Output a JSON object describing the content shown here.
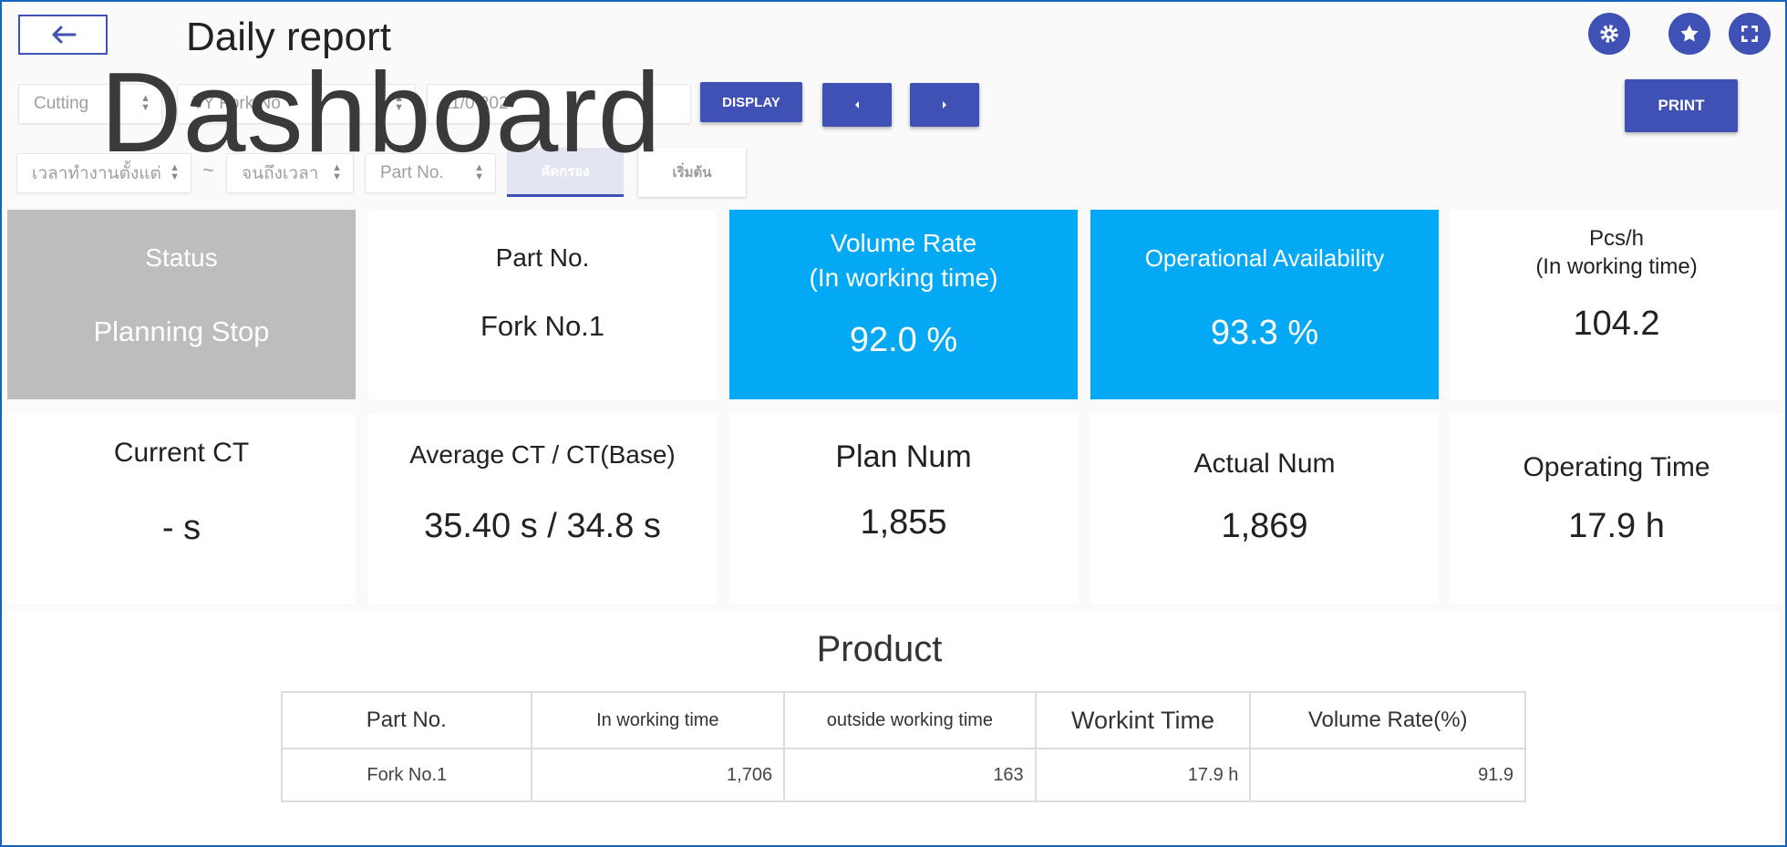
{
  "header": {
    "title": "Daily report",
    "watermark": "Dashboard",
    "back_icon": "arrow-left-icon",
    "settings_icon": "gear-icon",
    "favorite_icon": "star-icon",
    "fullscreen_icon": "fullscreen-icon"
  },
  "filters": {
    "process": "Cutting",
    "machine": "TY Fork No",
    "date": "11/0 202",
    "work_time_from": "เวลาทำงานตั้งแต่",
    "tilde": "~",
    "work_time_to": "จนถึงเวลา",
    "part_no": "Part No.",
    "filter_label": "คัดกรอง",
    "reset_label": "เริ่มต้น"
  },
  "toolbar": {
    "display_label": "DISPLAY",
    "prev_icon": "caret-left-icon",
    "next_icon": "caret-right-icon",
    "print_label": "PRINT"
  },
  "cards": {
    "status": {
      "label": "Status",
      "value": "Planning Stop"
    },
    "part_no": {
      "label": "Part No.",
      "value": "Fork No.1"
    },
    "volume_rate": {
      "label1": "Volume Rate",
      "label2": "(In working time)",
      "value": "92.0 %"
    },
    "availability": {
      "label": "Operational Availability",
      "value": "93.3 %"
    },
    "pcs_h": {
      "label1": "Pcs/h",
      "label2": "(In working time)",
      "value": "104.2"
    },
    "current_ct": {
      "label": "Current CT",
      "value": "- s"
    },
    "average_ct": {
      "label": "Average CT / CT(Base)",
      "value": "35.40 s / 34.8 s"
    },
    "plan_num": {
      "label": "Plan Num",
      "value": "1,855"
    },
    "actual_num": {
      "label": "Actual Num",
      "value": "1,869"
    },
    "operating_time": {
      "label": "Operating Time",
      "value": "17.9 h"
    }
  },
  "colors": {
    "primary": "#3f51b5",
    "highlight": "#03a9f4",
    "status_gray": "#bdbdbd"
  },
  "product": {
    "title": "Product",
    "columns": [
      "Part No.",
      "In working time",
      "outside working time",
      "Workint Time",
      "Volume Rate(%)"
    ],
    "rows": [
      [
        "Fork No.1",
        "1,706",
        "163",
        "17.9 h",
        "91.9"
      ]
    ]
  }
}
